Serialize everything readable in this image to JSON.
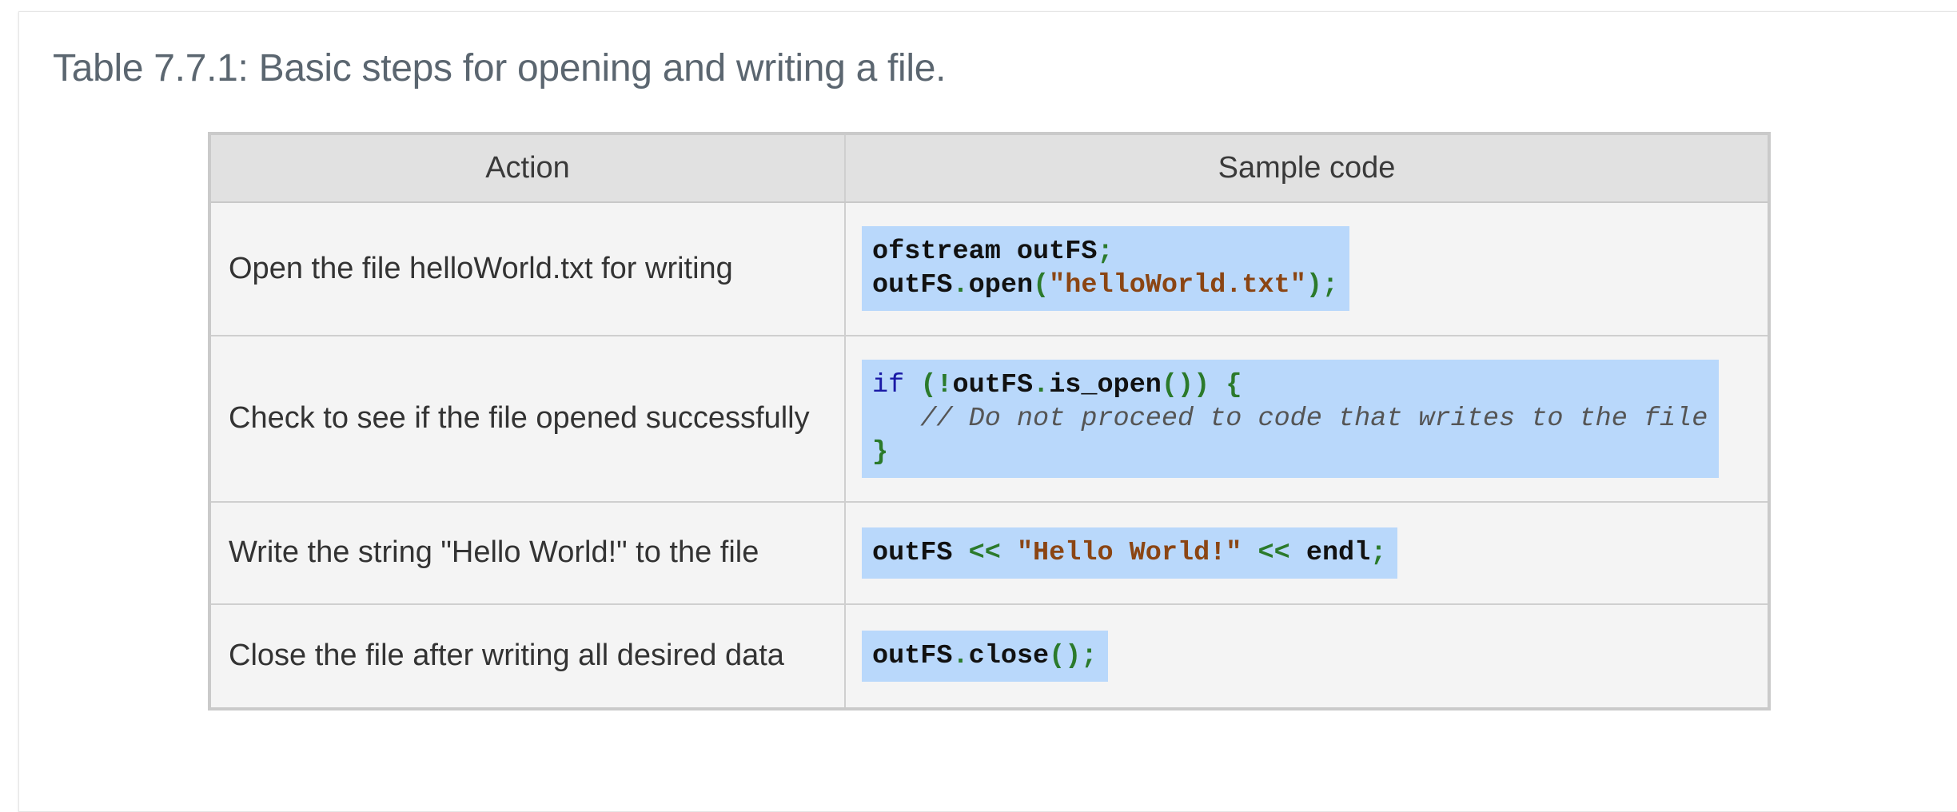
{
  "caption": "Table 7.7.1: Basic steps for opening and writing a file.",
  "table": {
    "headers": [
      "Action",
      "Sample code"
    ],
    "rows": [
      {
        "action": "Open the file helloWorld.txt for writing",
        "code": [
          [
            {
              "t": "ofstream outFS",
              "c": "plain"
            },
            {
              "t": ";",
              "c": "op"
            }
          ],
          [
            {
              "t": "outFS",
              "c": "plain"
            },
            {
              "t": ".",
              "c": "op"
            },
            {
              "t": "open",
              "c": "plain"
            },
            {
              "t": "(",
              "c": "op"
            },
            {
              "t": "\"helloWorld.txt\"",
              "c": "str"
            },
            {
              "t": ");",
              "c": "op"
            }
          ]
        ]
      },
      {
        "action": "Check to see if the file opened successfully",
        "code": [
          [
            {
              "t": "if",
              "c": "kw"
            },
            {
              "t": " ",
              "c": "plain"
            },
            {
              "t": "(!",
              "c": "op"
            },
            {
              "t": "outFS",
              "c": "plain"
            },
            {
              "t": ".",
              "c": "op"
            },
            {
              "t": "is_open",
              "c": "plain"
            },
            {
              "t": "()) {",
              "c": "op"
            }
          ],
          [
            {
              "t": "   // Do not proceed to code that writes to the file",
              "c": "cm"
            }
          ],
          [
            {
              "t": "}",
              "c": "op"
            }
          ]
        ]
      },
      {
        "action": "Write the string \"Hello World!\" to the file",
        "code": [
          [
            {
              "t": "outFS ",
              "c": "plain"
            },
            {
              "t": "<<",
              "c": "op"
            },
            {
              "t": " ",
              "c": "plain"
            },
            {
              "t": "\"Hello World!\"",
              "c": "str"
            },
            {
              "t": " ",
              "c": "plain"
            },
            {
              "t": "<<",
              "c": "op"
            },
            {
              "t": " endl",
              "c": "plain"
            },
            {
              "t": ";",
              "c": "op"
            }
          ]
        ]
      },
      {
        "action": "Close the file after writing all desired data",
        "code": [
          [
            {
              "t": "outFS",
              "c": "plain"
            },
            {
              "t": ".",
              "c": "op"
            },
            {
              "t": "close",
              "c": "plain"
            },
            {
              "t": "();",
              "c": "op"
            }
          ]
        ]
      }
    ]
  },
  "colors": {
    "code_background": "#b9d8fb",
    "keyword": "#1a1aa6",
    "operator": "#2b7a2b",
    "string": "#8b4513",
    "comment": "#555555"
  }
}
